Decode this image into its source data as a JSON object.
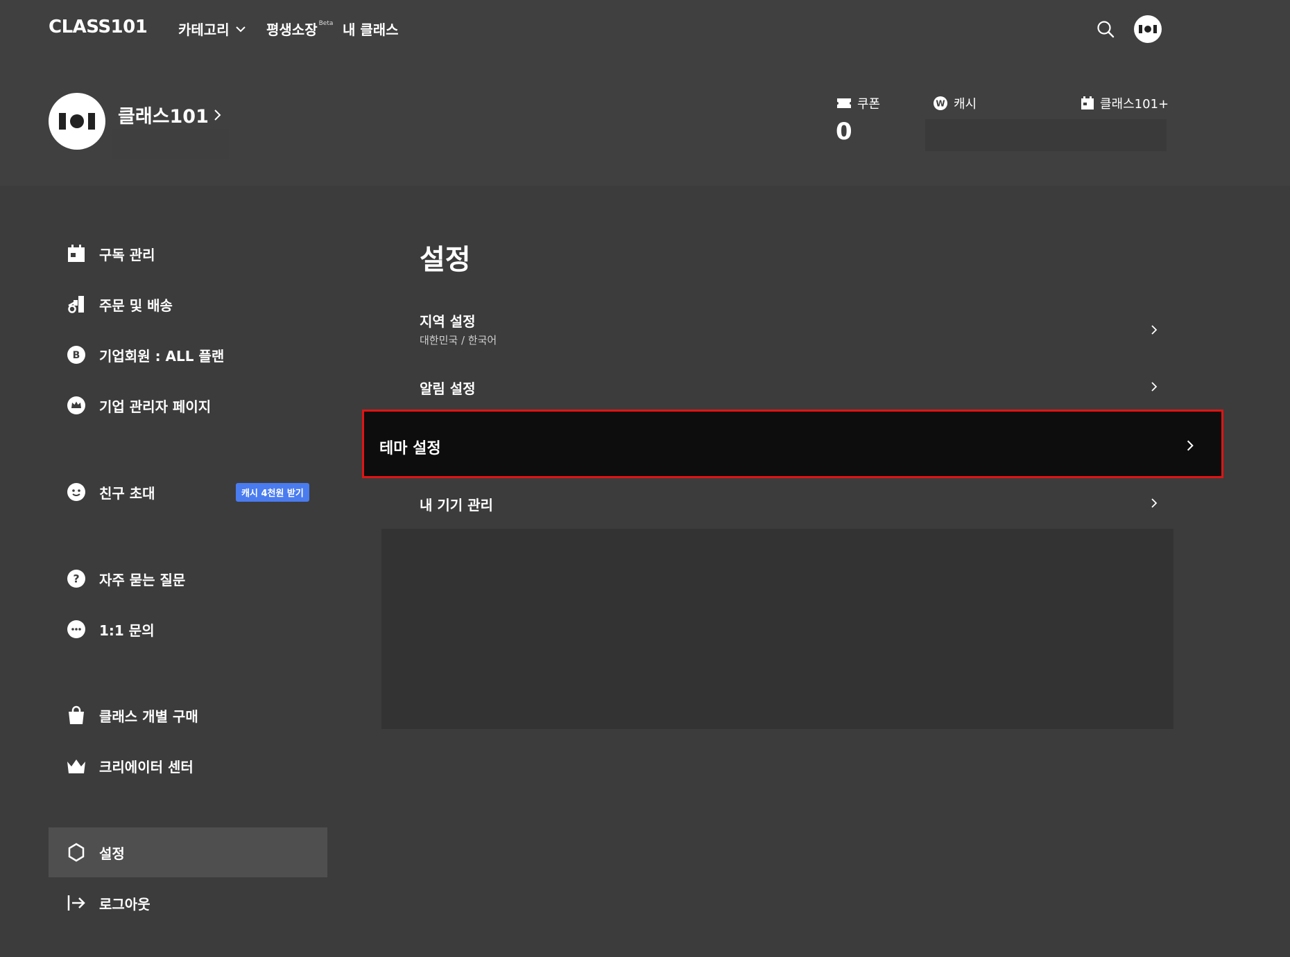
{
  "topnav": {
    "logo": "CLASS101",
    "category": "카테고리",
    "lifetime": "평생소장",
    "lifetime_badge": "Beta",
    "my_class": "내 클래스"
  },
  "profile": {
    "name": "클래스101",
    "coupon_label": "쿠폰",
    "coupon_value": "0",
    "cash_label": "캐시",
    "plus_label": "클래스101+"
  },
  "sidebar": {
    "items": [
      {
        "label": "구독 관리",
        "icon": "calendar-icon"
      },
      {
        "label": "주문 및 배송",
        "icon": "delivery-icon"
      },
      {
        "label": "기업회원 : ALL 플랜",
        "icon": "business-b-icon"
      },
      {
        "label": "기업 관리자 페이지",
        "icon": "crown-circle-icon"
      },
      {
        "label": "친구 초대",
        "icon": "smile-icon",
        "badge": "캐시 4천원 받기"
      },
      {
        "label": "자주 묻는 질문",
        "icon": "question-icon"
      },
      {
        "label": "1:1 문의",
        "icon": "chat-bubble-icon"
      },
      {
        "label": "클래스 개별 구매",
        "icon": "shopping-bag-icon"
      },
      {
        "label": "크리에이터 센터",
        "icon": "crown-icon"
      },
      {
        "label": "설정",
        "icon": "gear-icon",
        "active": true
      },
      {
        "label": "로그아웃",
        "icon": "logout-icon"
      }
    ]
  },
  "main": {
    "title": "설정",
    "rows": [
      {
        "label": "지역 설정",
        "sub": "대한민국 / 한국어"
      },
      {
        "label": "알림 설정"
      },
      {
        "label": "테마 설정",
        "highlighted": true
      },
      {
        "label": "내 기기 관리"
      }
    ]
  },
  "colors": {
    "background": "#3c3c3c",
    "header": "#404040",
    "highlight_border": "#e01414",
    "highlight_bg": "#0d0d0d",
    "badge": "#4a7cf0"
  }
}
